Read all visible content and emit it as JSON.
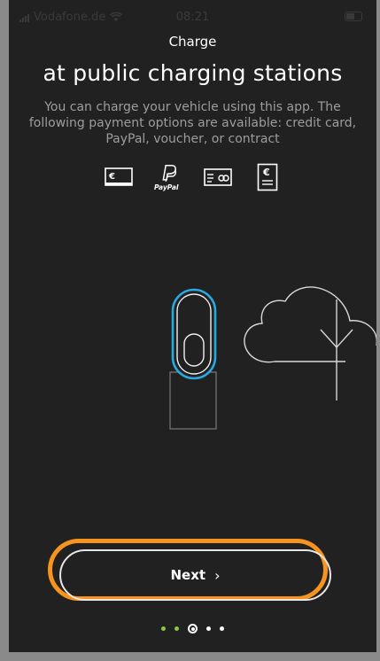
{
  "status": {
    "carrier": "Vodafone.de",
    "time": "08:21"
  },
  "header": {
    "small_title": "Charge",
    "large_title": "at public charging stations"
  },
  "description": {
    "line1": "You can charge your vehicle using this app. The",
    "line2": "following payment options are available: credit card,",
    "line3": "PayPal, voucher, or contract"
  },
  "payment_icons": [
    "credit-card-icon",
    "paypal-icon",
    "voucher-icon",
    "contract-icon"
  ],
  "paypal_label": "PayPal",
  "euro_symbol": "€",
  "next_button": {
    "label": "Next",
    "chevron": "›"
  },
  "pager": {
    "pages": 5,
    "current": 3
  },
  "colors": {
    "background": "#212121",
    "highlight": "#f7941d",
    "accent_blue": "#2aa8e0",
    "dot_done": "#8dc63f"
  }
}
